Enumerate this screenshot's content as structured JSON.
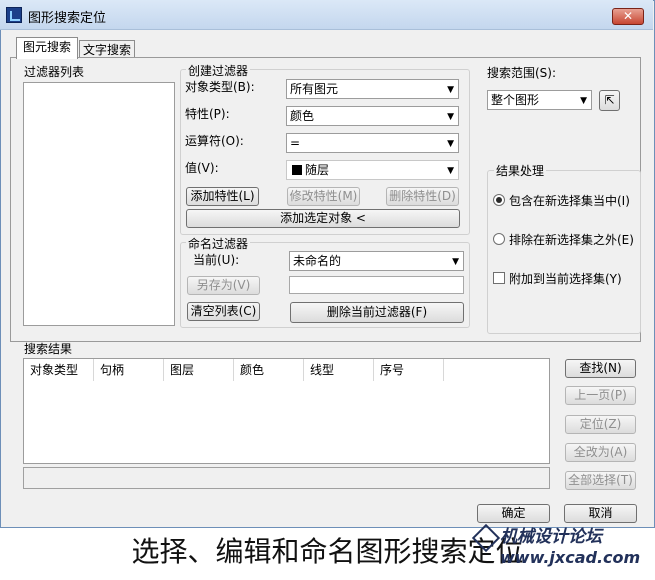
{
  "window": {
    "title": "图形搜索定位",
    "close_label": "✕"
  },
  "tabs": [
    {
      "label": "图元搜索",
      "active": true
    },
    {
      "label": "文字搜索",
      "active": false
    }
  ],
  "filter_list": {
    "label": "过滤器列表",
    "items": []
  },
  "create_filter": {
    "title": "创建过滤器",
    "object_type": {
      "label": "对象类型(B):",
      "value": "所有图元"
    },
    "property": {
      "label": "特性(P):",
      "value": "颜色"
    },
    "operator": {
      "label": "运算符(O):",
      "value": "="
    },
    "value": {
      "label": "值(V):",
      "value": "随层",
      "swatch_color": "#000000"
    },
    "add_property_button": "添加特性(L)",
    "modify_property_button": "修改特性(M)",
    "delete_property_button": "删除特性(D)",
    "add_selected_button": "添加选定对象 <"
  },
  "named_filter": {
    "title": "命名过滤器",
    "current_label": "当前(U):",
    "current_value": "未命名的",
    "save_as_button": "另存为(V)",
    "save_as_value": "",
    "clear_list_button": "清空列表(C)",
    "delete_filter_button": "删除当前过滤器(F)"
  },
  "search_scope": {
    "label": "搜索范围(S):",
    "value": "整个图形",
    "pick_icon": "select-objects-icon"
  },
  "result_handling": {
    "title": "结果处理",
    "option_include": "包含在新选择集当中(I)",
    "option_exclude": "排除在新选择集之外(E)",
    "option_append": "附加到当前选择集(Y)",
    "selected": "include",
    "append_checked": false
  },
  "search_results": {
    "label": "搜索结果",
    "columns": [
      "对象类型",
      "句柄",
      "图层",
      "颜色",
      "线型",
      "序号"
    ],
    "rows": [],
    "status_text": ""
  },
  "side_buttons": {
    "find": "查找(N)",
    "prev_page": "上一页(P)",
    "locate": "定位(Z)",
    "replace_all": "全改为(A)",
    "select_all": "全部选择(T)"
  },
  "footer": {
    "ok": "确定",
    "cancel": "取消"
  },
  "caption": "选择、编辑和命名图形搜索定位",
  "watermark": {
    "name": "机械设计论坛",
    "url": "www.jxcad.com"
  },
  "colors": {
    "title_bar": "#c4d7ee",
    "dialog_bg": "#f0f0f0",
    "close_button": "#c74632"
  }
}
